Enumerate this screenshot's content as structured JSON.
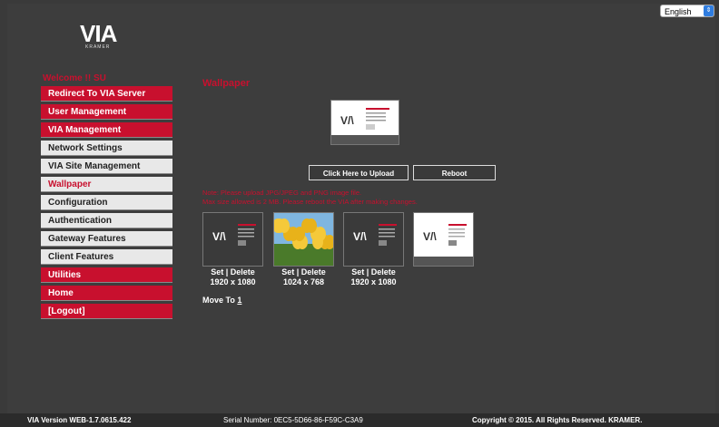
{
  "language": {
    "selected": "English"
  },
  "logo": {
    "main": "VIA",
    "sub": "KRAMER"
  },
  "welcome": "Welcome !! SU",
  "menu": [
    {
      "label": "Redirect To VIA Server",
      "style": "red"
    },
    {
      "label": "User Management",
      "style": "red"
    },
    {
      "label": "VIA Management",
      "style": "red"
    },
    {
      "label": "Network Settings",
      "style": "grey"
    },
    {
      "label": "VIA Site Management",
      "style": "grey"
    },
    {
      "label": "Wallpaper",
      "style": "active"
    },
    {
      "label": "Configuration",
      "style": "grey"
    },
    {
      "label": "Authentication",
      "style": "grey"
    },
    {
      "label": "Gateway Features",
      "style": "grey"
    },
    {
      "label": "Client Features",
      "style": "grey"
    },
    {
      "label": "Utilities",
      "style": "red"
    },
    {
      "label": "Home",
      "style": "red"
    },
    {
      "label": "[Logout]",
      "style": "red"
    }
  ],
  "content": {
    "title": "Wallpaper",
    "upload_label": "Click Here to Upload",
    "reboot_label": "Reboot",
    "note_line1": "Note: Please upload JPG/JPEG and PNG image file.",
    "note_line2": "Max size allowed is 2 MB. Please reboot the VIA after making changes.",
    "thumbnails": [
      {
        "actions": "Set | Delete",
        "resolution": "1920 x 1080",
        "kind": "dark-ui"
      },
      {
        "actions": "Set | Delete",
        "resolution": "1024 x 768",
        "kind": "tulips"
      },
      {
        "actions": "Set | Delete",
        "resolution": "1920 x 1080",
        "kind": "dark-ui"
      },
      {
        "actions": "",
        "resolution": "",
        "kind": "light-ui"
      }
    ],
    "move_to_label": "Move To",
    "move_to_page": "1"
  },
  "footer": {
    "version": "VIA Version WEB-1.7.0615.422",
    "serial": "Serial Number: 0EC5-5D66-86-F59C-C3A9",
    "copyright": "Copyright © 2015. All Rights Reserved. KRAMER."
  },
  "colors": {
    "accent": "#c8102e",
    "background": "#3d3d3d",
    "menu_grey": "#e8e8e8"
  }
}
